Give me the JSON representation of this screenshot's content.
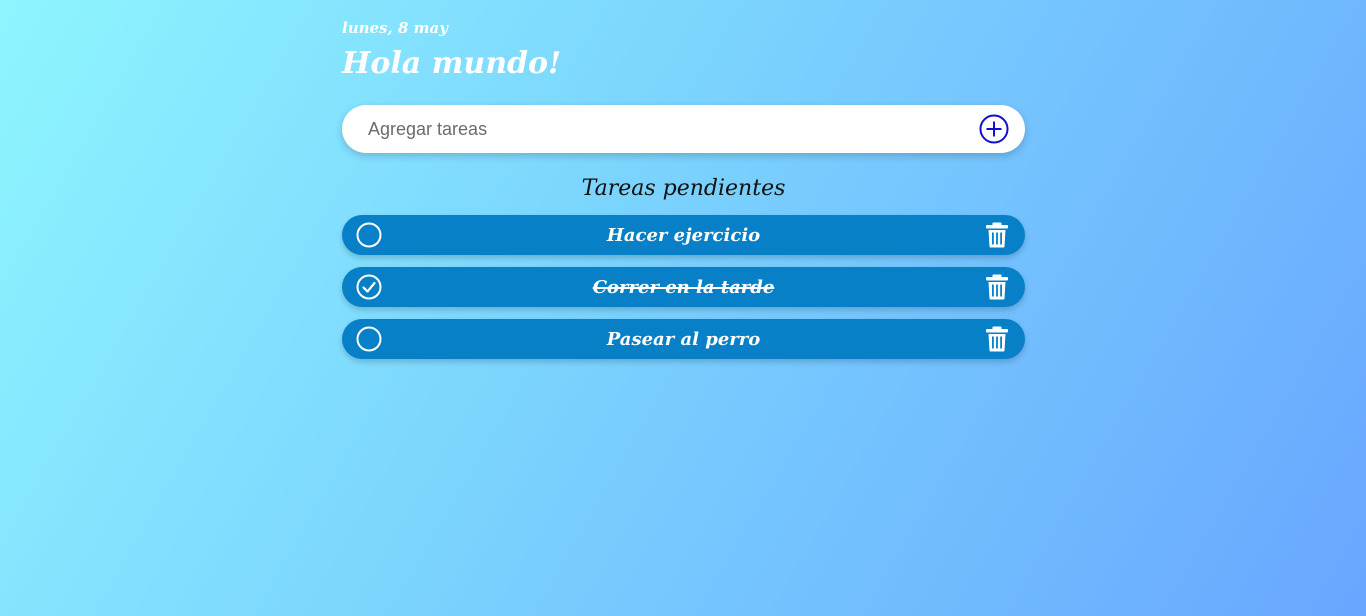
{
  "header": {
    "date": "lunes, 8 may",
    "title": "Hola mundo!"
  },
  "add_task": {
    "placeholder": "Agregar tareas",
    "value": "",
    "button_icon": "plus-circle-icon"
  },
  "tasks_section": {
    "title": "Tareas pendientes",
    "items": [
      {
        "label": "Hacer ejercicio",
        "completed": false,
        "check_icon": "circle-icon",
        "delete_icon": "trash-icon"
      },
      {
        "label": "Correr en la tarde",
        "completed": true,
        "check_icon": "check-circle-icon",
        "delete_icon": "trash-icon"
      },
      {
        "label": "Pasear al perro",
        "completed": false,
        "check_icon": "circle-icon",
        "delete_icon": "trash-icon"
      }
    ]
  },
  "colors": {
    "background_start": "#8ef5ff",
    "background_end": "#68a6ff",
    "task_bg": "#0780c8",
    "add_icon": "#1010d0",
    "text_light": "#ffffff"
  }
}
